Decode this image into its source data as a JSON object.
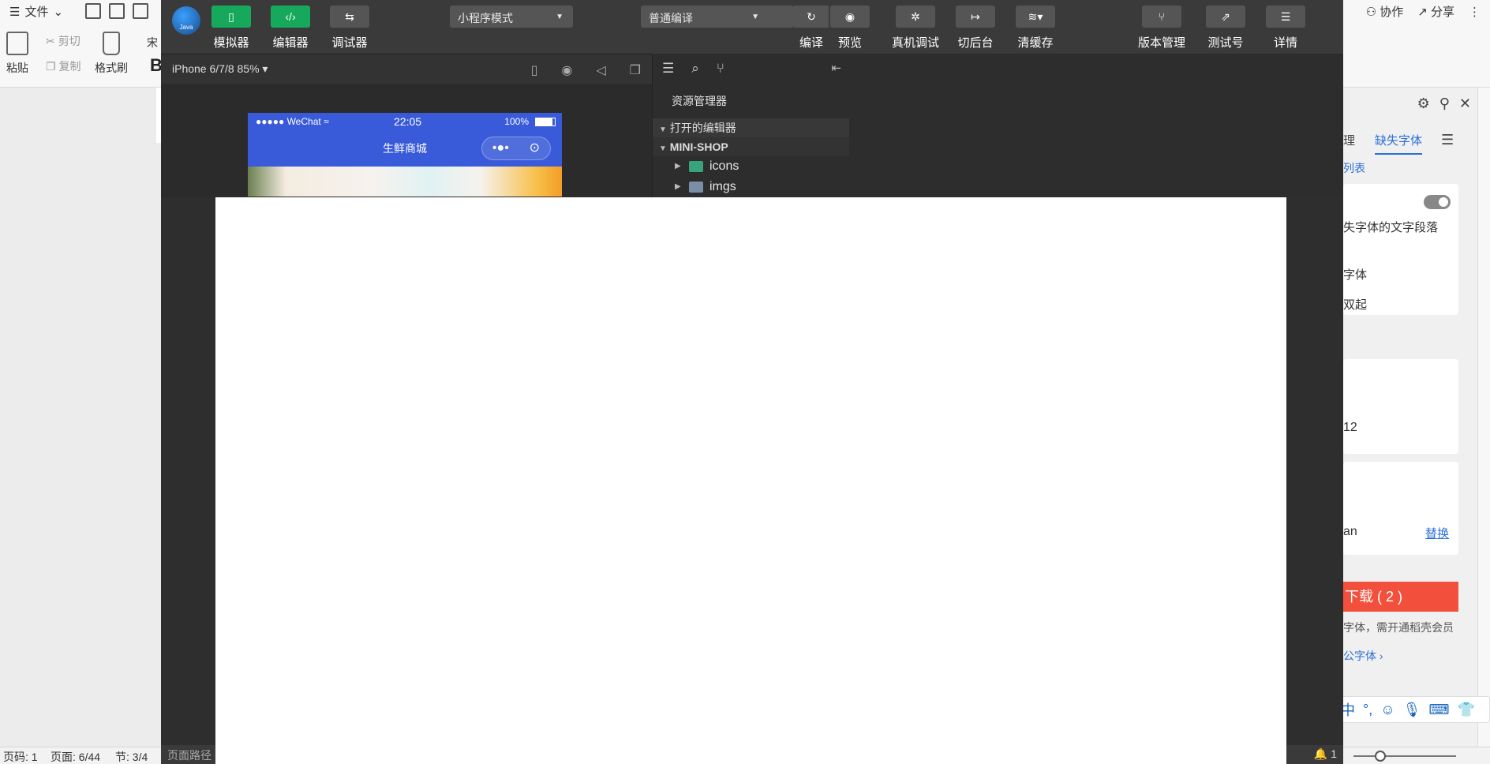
{
  "wps": {
    "menu": {
      "label": "文件"
    },
    "clipboard": {
      "paste": "粘贴",
      "cut": "剪切",
      "copy": "复制",
      "format_painter": "格式刷"
    },
    "font_prefix": "宋",
    "bold": "B",
    "actions": {
      "collab": "协作",
      "share": "分享"
    },
    "status": {
      "page_code": "页码: 1",
      "pages": "页面: 6/44",
      "section": "节: 3/4"
    },
    "taskpane": {
      "tab_left": "理",
      "tab_active": "缺失字体",
      "link_list": "列表",
      "text_missing_para": "失字体的文字段落",
      "text_font": "字体",
      "text_rise": "双起",
      "value_12": "12",
      "text_an": "an",
      "replace": "替换",
      "download": "下载 ( 2 )",
      "note_member": "字体，需开通稻壳会员",
      "note_public": "公字体"
    }
  },
  "devtools": {
    "toolbar": {
      "simulator": "模拟器",
      "editor": "编辑器",
      "debugger": "调试器",
      "mode": "小程序模式",
      "compile_mode": "普通编译",
      "compile": "编译",
      "preview": "预览",
      "remote_debug": "真机调试",
      "switch_backend": "切后台",
      "clear_cache": "清缓存",
      "version": "版本管理",
      "test_id": "测试号",
      "details": "详情"
    },
    "simulator": {
      "device": "iPhone 6/7/8 85%",
      "status_carrier": "●●●●● WeChat",
      "status_time": "22:05",
      "status_battery": "100%",
      "nav_title": "生鲜商城"
    },
    "explorer": {
      "title": "资源管理器",
      "open_editors": "打开的编辑器",
      "project": "MINI-SHOP",
      "items": [
        "icons",
        "imgs"
      ]
    },
    "status": {
      "page_path": "页面路径",
      "notifications": "1"
    }
  },
  "colors": {
    "accent_green": "#17a95b",
    "nav_blue": "#3a5bd9",
    "download_red": "#f2503c"
  }
}
